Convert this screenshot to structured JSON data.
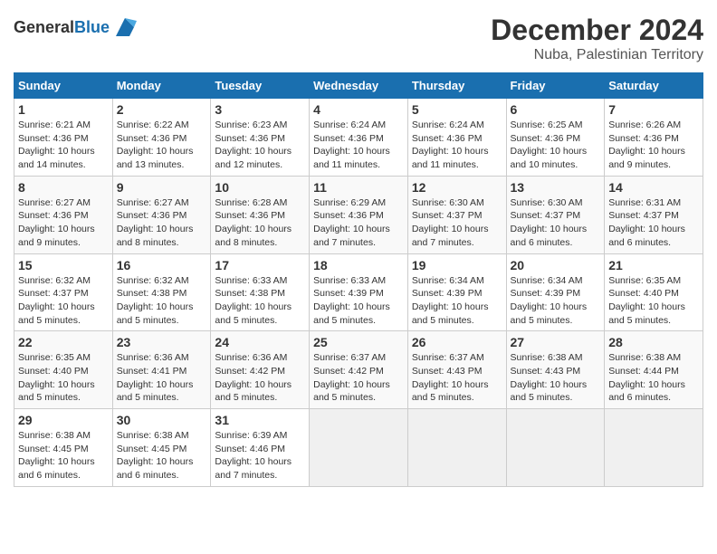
{
  "header": {
    "logo_general": "General",
    "logo_blue": "Blue",
    "main_title": "December 2024",
    "sub_title": "Nuba, Palestinian Territory"
  },
  "columns": [
    "Sunday",
    "Monday",
    "Tuesday",
    "Wednesday",
    "Thursday",
    "Friday",
    "Saturday"
  ],
  "weeks": [
    [
      {
        "day": "1",
        "sunrise": "6:21 AM",
        "sunset": "4:36 PM",
        "daylight": "10 hours and 14 minutes."
      },
      {
        "day": "2",
        "sunrise": "6:22 AM",
        "sunset": "4:36 PM",
        "daylight": "10 hours and 13 minutes."
      },
      {
        "day": "3",
        "sunrise": "6:23 AM",
        "sunset": "4:36 PM",
        "daylight": "10 hours and 12 minutes."
      },
      {
        "day": "4",
        "sunrise": "6:24 AM",
        "sunset": "4:36 PM",
        "daylight": "10 hours and 11 minutes."
      },
      {
        "day": "5",
        "sunrise": "6:24 AM",
        "sunset": "4:36 PM",
        "daylight": "10 hours and 11 minutes."
      },
      {
        "day": "6",
        "sunrise": "6:25 AM",
        "sunset": "4:36 PM",
        "daylight": "10 hours and 10 minutes."
      },
      {
        "day": "7",
        "sunrise": "6:26 AM",
        "sunset": "4:36 PM",
        "daylight": "10 hours and 9 minutes."
      }
    ],
    [
      {
        "day": "8",
        "sunrise": "6:27 AM",
        "sunset": "4:36 PM",
        "daylight": "10 hours and 9 minutes."
      },
      {
        "day": "9",
        "sunrise": "6:27 AM",
        "sunset": "4:36 PM",
        "daylight": "10 hours and 8 minutes."
      },
      {
        "day": "10",
        "sunrise": "6:28 AM",
        "sunset": "4:36 PM",
        "daylight": "10 hours and 8 minutes."
      },
      {
        "day": "11",
        "sunrise": "6:29 AM",
        "sunset": "4:36 PM",
        "daylight": "10 hours and 7 minutes."
      },
      {
        "day": "12",
        "sunrise": "6:30 AM",
        "sunset": "4:37 PM",
        "daylight": "10 hours and 7 minutes."
      },
      {
        "day": "13",
        "sunrise": "6:30 AM",
        "sunset": "4:37 PM",
        "daylight": "10 hours and 6 minutes."
      },
      {
        "day": "14",
        "sunrise": "6:31 AM",
        "sunset": "4:37 PM",
        "daylight": "10 hours and 6 minutes."
      }
    ],
    [
      {
        "day": "15",
        "sunrise": "6:32 AM",
        "sunset": "4:37 PM",
        "daylight": "10 hours and 5 minutes."
      },
      {
        "day": "16",
        "sunrise": "6:32 AM",
        "sunset": "4:38 PM",
        "daylight": "10 hours and 5 minutes."
      },
      {
        "day": "17",
        "sunrise": "6:33 AM",
        "sunset": "4:38 PM",
        "daylight": "10 hours and 5 minutes."
      },
      {
        "day": "18",
        "sunrise": "6:33 AM",
        "sunset": "4:39 PM",
        "daylight": "10 hours and 5 minutes."
      },
      {
        "day": "19",
        "sunrise": "6:34 AM",
        "sunset": "4:39 PM",
        "daylight": "10 hours and 5 minutes."
      },
      {
        "day": "20",
        "sunrise": "6:34 AM",
        "sunset": "4:39 PM",
        "daylight": "10 hours and 5 minutes."
      },
      {
        "day": "21",
        "sunrise": "6:35 AM",
        "sunset": "4:40 PM",
        "daylight": "10 hours and 5 minutes."
      }
    ],
    [
      {
        "day": "22",
        "sunrise": "6:35 AM",
        "sunset": "4:40 PM",
        "daylight": "10 hours and 5 minutes."
      },
      {
        "day": "23",
        "sunrise": "6:36 AM",
        "sunset": "4:41 PM",
        "daylight": "10 hours and 5 minutes."
      },
      {
        "day": "24",
        "sunrise": "6:36 AM",
        "sunset": "4:42 PM",
        "daylight": "10 hours and 5 minutes."
      },
      {
        "day": "25",
        "sunrise": "6:37 AM",
        "sunset": "4:42 PM",
        "daylight": "10 hours and 5 minutes."
      },
      {
        "day": "26",
        "sunrise": "6:37 AM",
        "sunset": "4:43 PM",
        "daylight": "10 hours and 5 minutes."
      },
      {
        "day": "27",
        "sunrise": "6:38 AM",
        "sunset": "4:43 PM",
        "daylight": "10 hours and 5 minutes."
      },
      {
        "day": "28",
        "sunrise": "6:38 AM",
        "sunset": "4:44 PM",
        "daylight": "10 hours and 6 minutes."
      }
    ],
    [
      {
        "day": "29",
        "sunrise": "6:38 AM",
        "sunset": "4:45 PM",
        "daylight": "10 hours and 6 minutes."
      },
      {
        "day": "30",
        "sunrise": "6:38 AM",
        "sunset": "4:45 PM",
        "daylight": "10 hours and 6 minutes."
      },
      {
        "day": "31",
        "sunrise": "6:39 AM",
        "sunset": "4:46 PM",
        "daylight": "10 hours and 7 minutes."
      },
      null,
      null,
      null,
      null
    ]
  ],
  "labels": {
    "sunrise_label": "Sunrise:",
    "sunset_label": "Sunset:",
    "daylight_label": "Daylight:"
  }
}
